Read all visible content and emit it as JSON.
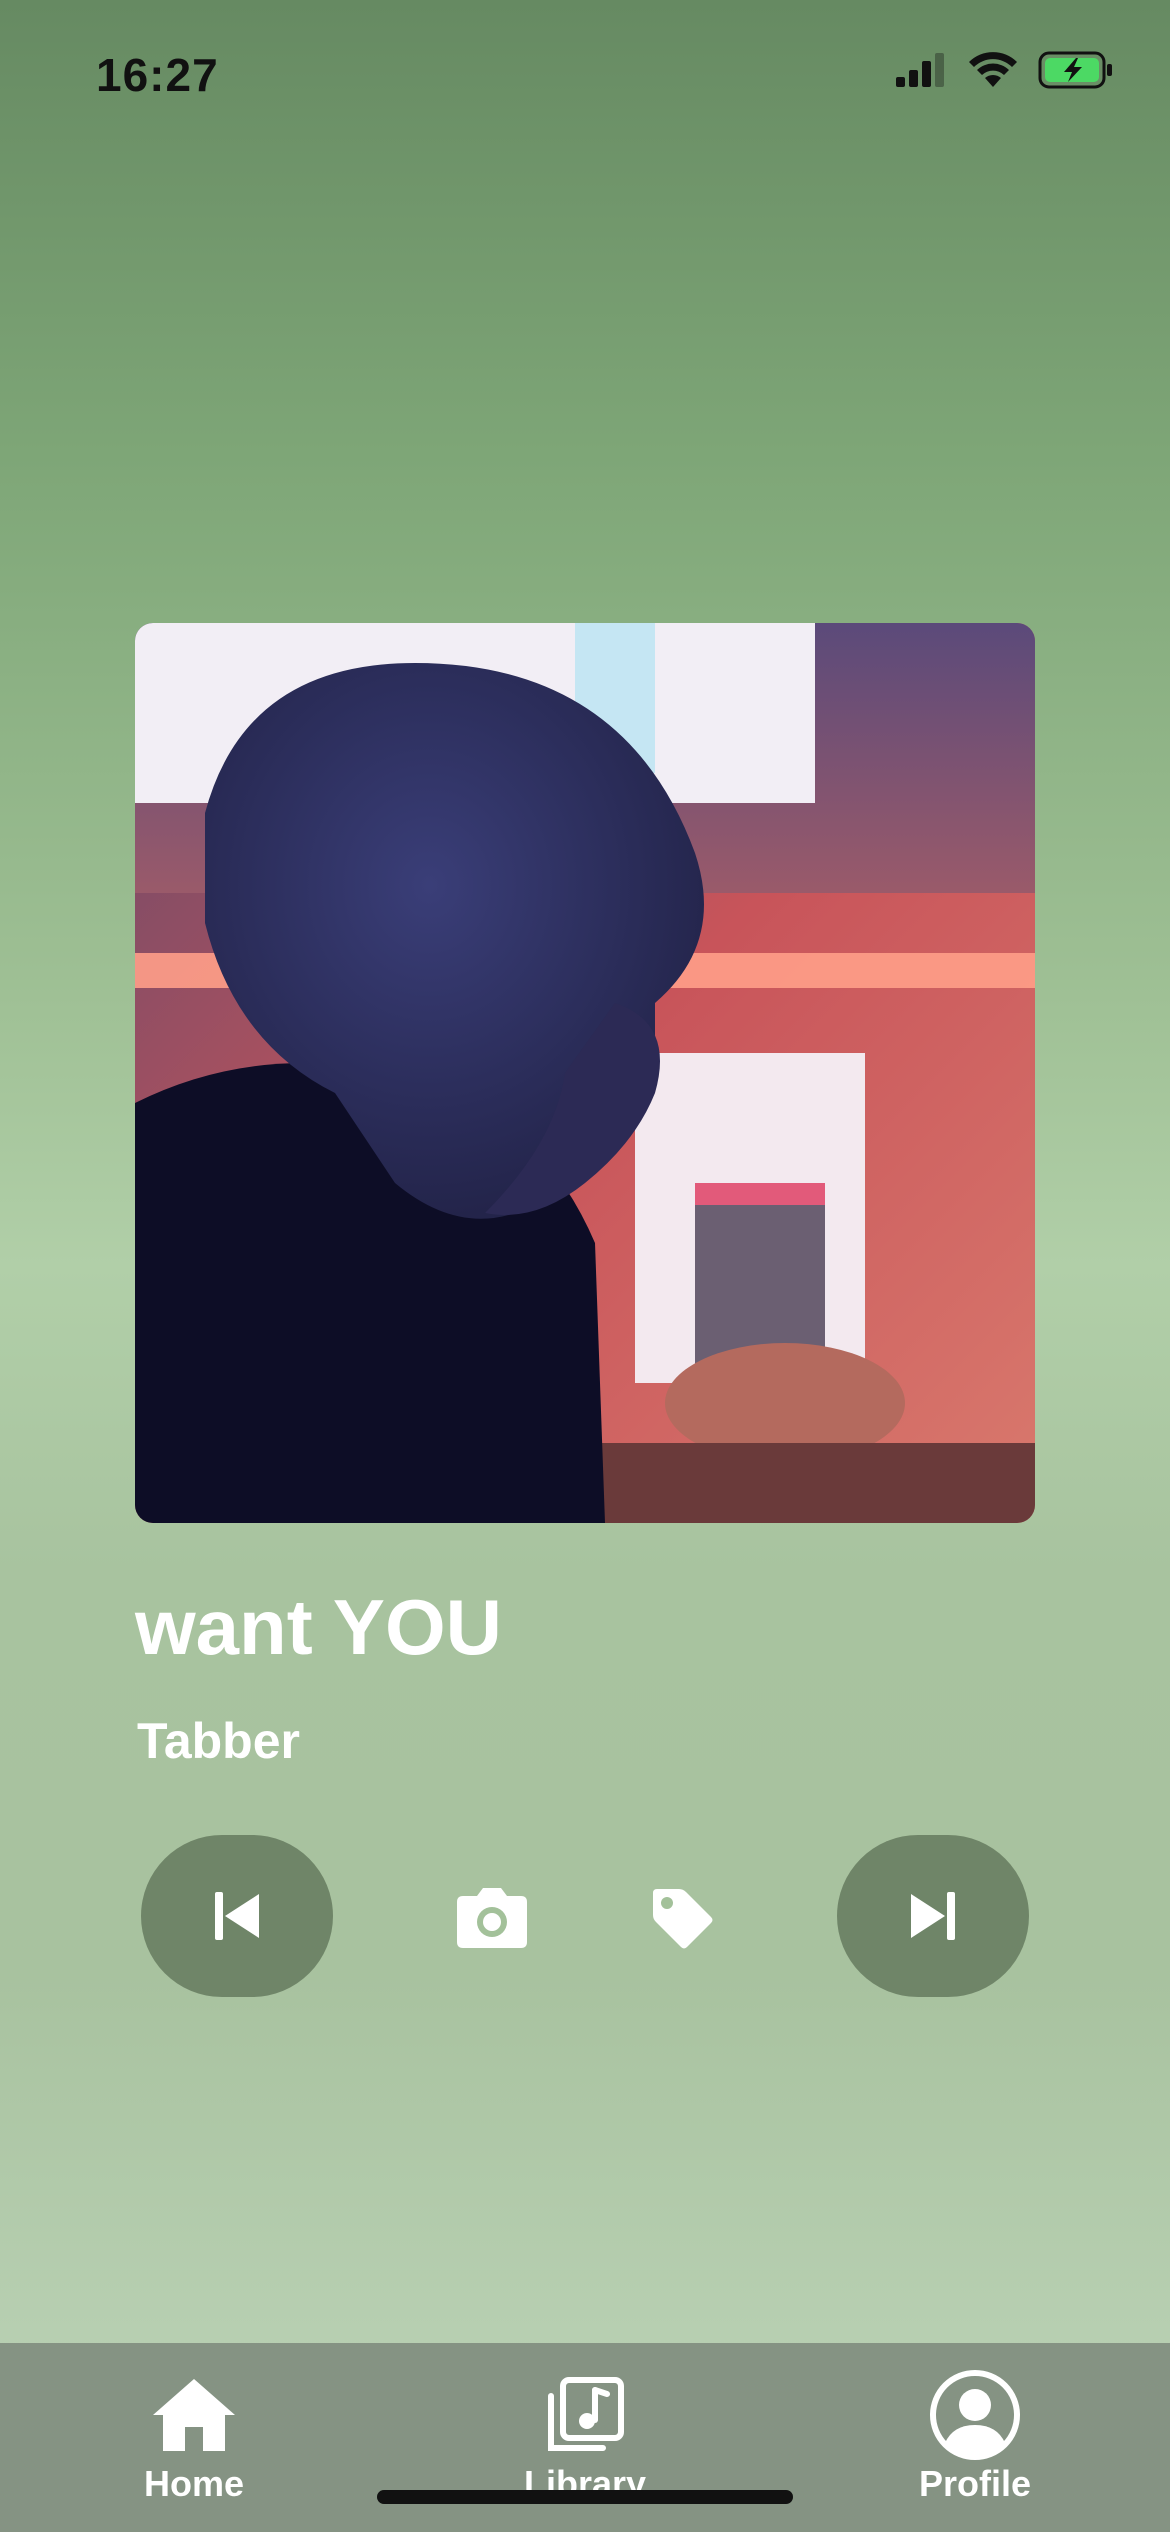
{
  "status_bar": {
    "time": "16:27"
  },
  "now_playing": {
    "title": "want YOU",
    "artist": "Tabber"
  },
  "controls": {
    "prev": "previous-track-icon",
    "camera": "camera-icon",
    "tag": "tag-icon",
    "next": "next-track-icon"
  },
  "tab_bar": {
    "tabs": [
      {
        "label": "Home",
        "icon": "home-icon"
      },
      {
        "label": "Library",
        "icon": "music-library-icon"
      },
      {
        "label": "Profile",
        "icon": "profile-icon"
      }
    ]
  },
  "colors": {
    "control_button": "#6f8568",
    "tab_bar": "#859383",
    "battery": "#4cd964"
  }
}
